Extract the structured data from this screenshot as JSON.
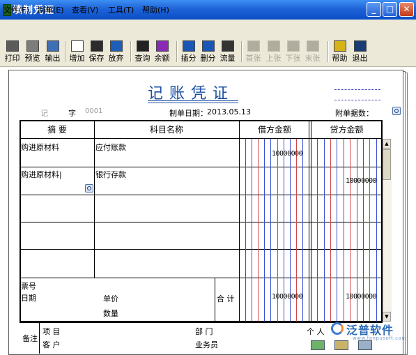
{
  "window": {
    "title": "填制凭证"
  },
  "menu": [
    "文件(F)",
    "制单(E)",
    "查看(V)",
    "工具(T)",
    "帮助(H)"
  ],
  "toolbar": [
    {
      "label": "打印",
      "icon": "printer-icon",
      "enabled": true
    },
    {
      "label": "预览",
      "icon": "preview-icon",
      "enabled": true
    },
    {
      "label": "输出",
      "icon": "export-icon",
      "enabled": true
    },
    {
      "label": "增加",
      "icon": "add-icon",
      "enabled": true
    },
    {
      "label": "保存",
      "icon": "save-icon",
      "enabled": true
    },
    {
      "label": "放弃",
      "icon": "undo-icon",
      "enabled": true
    },
    {
      "label": "查询",
      "icon": "binoculars-icon",
      "enabled": true
    },
    {
      "label": "余额",
      "icon": "balance-chart-icon",
      "enabled": true
    },
    {
      "label": "插分",
      "icon": "insert-row-icon",
      "enabled": true
    },
    {
      "label": "删分",
      "icon": "delete-row-icon",
      "enabled": true
    },
    {
      "label": "流量",
      "icon": "cashflow-icon",
      "enabled": true
    },
    {
      "label": "首张",
      "icon": "first-icon",
      "enabled": false
    },
    {
      "label": "上张",
      "icon": "prev-icon",
      "enabled": false
    },
    {
      "label": "下张",
      "icon": "next-icon",
      "enabled": false
    },
    {
      "label": "末张",
      "icon": "last-icon",
      "enabled": false
    },
    {
      "label": "帮助",
      "icon": "help-icon",
      "enabled": true
    },
    {
      "label": "退出",
      "icon": "exit-icon",
      "enabled": true
    }
  ],
  "voucher": {
    "title": "记账凭证",
    "type_value": "记",
    "type_label": "字",
    "number": "0001",
    "date_label": "制单日期：",
    "date_value": "2013.05.13",
    "attachments_label": "附单据数："
  },
  "table": {
    "headers": {
      "summary": "摘  要",
      "account": "科目名称",
      "debit": "借方金额",
      "credit": "贷方金额"
    },
    "rows": [
      {
        "summary": "购进原材料",
        "account": "应付账款",
        "debit": "10000000",
        "credit": ""
      },
      {
        "summary": "购进原材料|",
        "account": "银行存款",
        "debit": "",
        "credit": "10000000"
      },
      {
        "summary": "",
        "account": "",
        "debit": "",
        "credit": ""
      },
      {
        "summary": "",
        "account": "",
        "debit": "",
        "credit": ""
      },
      {
        "summary": "",
        "account": "",
        "debit": "",
        "credit": ""
      }
    ],
    "footer": {
      "ticket_no_label": "票号",
      "date_label": "日期",
      "unit_price_label": "单价",
      "quantity_label": "数量",
      "total_label": "合 计",
      "debit_total": "10000000",
      "credit_total": "10000000"
    }
  },
  "bottom": {
    "remark_label": "备注",
    "project_label": "项  目",
    "customer_label": "客  户",
    "department_label": "部  门",
    "salesperson_label": "业务员",
    "person_label": "个  人"
  },
  "watermark": {
    "brand": "泛普软件",
    "url": "www.fanpusoft.com"
  },
  "colors": {
    "titlebar": "#1f63d8",
    "title_text": "#1a4fa3",
    "ledger_red": "#d24848",
    "ledger_blue": "#3a4fd0"
  }
}
